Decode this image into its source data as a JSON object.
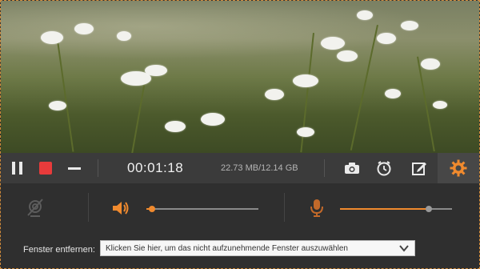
{
  "toolbar": {
    "timer": "00:01:18",
    "file_size": "22.73 MB/12.14 GB"
  },
  "controls": {
    "speaker_volume": 0.05,
    "microphone_volume": 0.79,
    "accent_color": "#f08a2e"
  },
  "bottom": {
    "exclude_label": "Fenster entfernen:",
    "exclude_placeholder": "Klicken Sie hier, um das nicht aufzunehmende Fenster auszuwählen"
  },
  "icons": [
    "pause-icon",
    "stop-icon",
    "minimize-icon",
    "camera-icon",
    "clock-icon",
    "edit-icon",
    "gear-icon",
    "webcam-off-icon",
    "speaker-icon",
    "microphone-icon",
    "chevron-down-icon"
  ]
}
